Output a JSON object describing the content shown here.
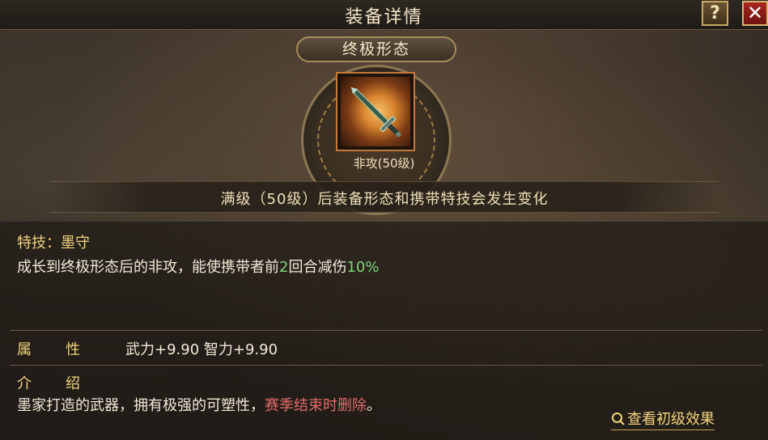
{
  "header": {
    "title": "装备详情",
    "help_label": "?",
    "close_label": "✕"
  },
  "equipment": {
    "form_label": "终极形态",
    "name": "非攻(50级)",
    "icon": "sword-icon",
    "note": "满级（50级）后装备形态和携带特技会发生变化"
  },
  "skill": {
    "title": "特技：墨守",
    "desc_prefix": "成长到终极形态后的非攻，能使携带者前",
    "rounds": "2",
    "desc_mid": "回合减伤",
    "reduction": "10%"
  },
  "attributes": {
    "label": "属性",
    "value": "武力+9.90  智力+9.90"
  },
  "intro": {
    "label": "介绍",
    "desc": "墨家打造的武器，拥有极强的可塑性，",
    "warning": "赛季结束时删除",
    "end": "。"
  },
  "actions": {
    "view_initial_label": "查看初级效果"
  },
  "colors": {
    "gold": "#f2d37d",
    "green": "#7fd67a",
    "red": "#e26a6a"
  }
}
